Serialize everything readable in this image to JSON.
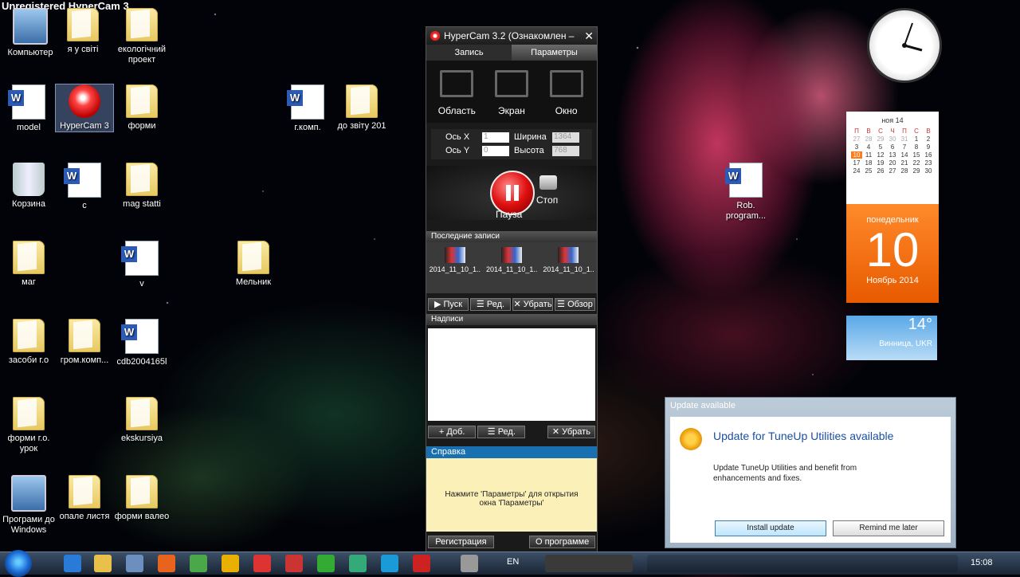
{
  "watermark": "Unregistered HyperCam 3",
  "desktop_icons": [
    {
      "label": "Компьютер",
      "type": "pc"
    },
    {
      "label": "я у світі",
      "type": "folder"
    },
    {
      "label": "екологічний проект",
      "type": "folder"
    },
    {
      "label": "model",
      "type": "doc"
    },
    {
      "label": "HyperCam 3",
      "type": "hcam"
    },
    {
      "label": "форми",
      "type": "folder"
    },
    {
      "label": "г.комп.",
      "type": "doc"
    },
    {
      "label": "до звіту 201",
      "type": "folder"
    },
    {
      "label": "Корзина",
      "type": "bin"
    },
    {
      "label": "с",
      "type": "doc"
    },
    {
      "label": "mag statti",
      "type": "folder"
    },
    {
      "label": "маг",
      "type": "folder"
    },
    {
      "label": "v",
      "type": "doc"
    },
    {
      "label": "Мельник",
      "type": "folder"
    },
    {
      "label": "засоби г.о",
      "type": "folder"
    },
    {
      "label": "гром.комп...",
      "type": "folder"
    },
    {
      "label": "cdb2004165l",
      "type": "doc"
    },
    {
      "label": "форми г.о. урок",
      "type": "folder"
    },
    {
      "label": "ekskursiya",
      "type": "folder"
    },
    {
      "label": "Програми до Windows",
      "type": "pc"
    },
    {
      "label": "опале листя",
      "type": "folder"
    },
    {
      "label": "форми валео",
      "type": "folder"
    },
    {
      "label": "Rob. program...",
      "type": "doc"
    }
  ],
  "hypercam": {
    "title": "HyperCam 3.2 (Ознакомлен –",
    "tab_record": "Запись",
    "tab_params": "Параметры",
    "mode_area": "Область",
    "mode_screen": "Экран",
    "mode_window": "Окно",
    "axis_x_label": "Ось X",
    "axis_y_label": "Ось Y",
    "width_label": "Ширина",
    "height_label": "Высота",
    "x": "1",
    "y": "0",
    "width": "1364",
    "height": "768",
    "pause": "Пауза",
    "stop": "Стоп",
    "recent_header": "Последние записи",
    "recent": [
      "2014_11_10_1...",
      "2014_11_10_1...",
      "2014_11_10_1..."
    ],
    "btn_play": "Пуск",
    "btn_edit": "Ред.",
    "btn_remove": "Убрать",
    "btn_browse": "Обзор",
    "notes_header": "Надписи",
    "btn_add": "Доб.",
    "btn_edit2": "Ред.",
    "btn_remove2": "Убрать",
    "help_header": "Справка",
    "help_text": "Нажмите 'Параметры' для открытия окна 'Параметры'",
    "btn_register": "Регистрация",
    "btn_about": "О программе"
  },
  "calendar": {
    "month_header": "ноя 14",
    "dow": [
      "П",
      "В",
      "С",
      "Ч",
      "П",
      "С",
      "В"
    ],
    "days": [
      "27",
      "28",
      "29",
      "30",
      "31",
      "1",
      "2",
      "3",
      "4",
      "5",
      "6",
      "7",
      "8",
      "9",
      "10",
      "11",
      "12",
      "13",
      "14",
      "15",
      "16",
      "17",
      "18",
      "19",
      "20",
      "21",
      "22",
      "23",
      "24",
      "25",
      "26",
      "27",
      "28",
      "29",
      "30"
    ],
    "today": "10",
    "weekday": "понедельник",
    "day": "10",
    "month_year": "Ноябрь 2014"
  },
  "weather": {
    "temp": "14°",
    "city": "Винница, UKR"
  },
  "popup": {
    "header": "Update available",
    "title": "Update for TuneUp Utilities available",
    "text": "Update TuneUp Utilities and benefit from enhancements and fixes.",
    "install": "Install update",
    "later": "Remind me later"
  },
  "taskbar": {
    "lang": "EN",
    "time": "15:08"
  }
}
